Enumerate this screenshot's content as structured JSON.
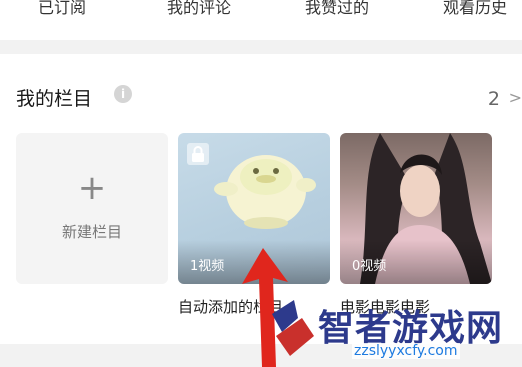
{
  "top_tabs": [
    {
      "label": "已订阅"
    },
    {
      "label": "我的评论"
    },
    {
      "label": "我赞过的"
    },
    {
      "label": "观看历史"
    }
  ],
  "section": {
    "title": "我的栏目",
    "info_icon": "info-icon",
    "count": "2",
    "chevron": ">"
  },
  "cards": {
    "new": {
      "plus": "+",
      "label": "新建栏目"
    },
    "auto": {
      "video_count": "1视频",
      "title": "自动添加的栏目"
    },
    "movie": {
      "video_count": "0视频",
      "title": "电影电影电影"
    }
  },
  "watermark": {
    "brand": "智者游戏网",
    "url": "zzslyyxcfy.com"
  },
  "colors": {
    "accent_red": "#e0261d",
    "watermark_blue": "#2d3a8c"
  }
}
